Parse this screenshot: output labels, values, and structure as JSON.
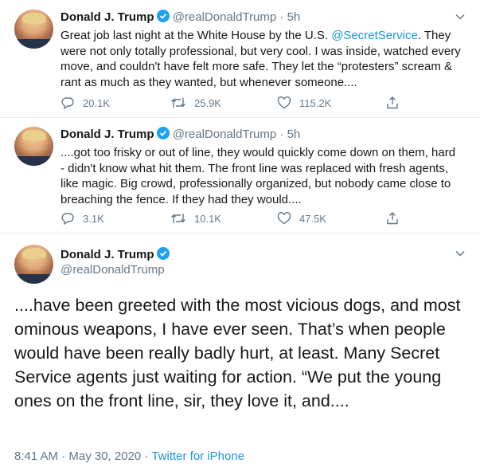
{
  "tweets": [
    {
      "name": "Donald J. Trump",
      "handle": "@realDonaldTrump",
      "sep": "·",
      "time": "5h",
      "text_before": "Great job last night at the White House by the U.S. ",
      "mention": "@SecretService",
      "text_after": ". They were not only totally professional, but very cool. I was inside, watched every move, and couldn't have felt more safe. They let the “protesters” scream & rant as much as they wanted, but whenever someone....",
      "replies": "20.1K",
      "retweets": "25.9K",
      "likes": "115.2K"
    },
    {
      "name": "Donald J. Trump",
      "handle": "@realDonaldTrump",
      "sep": "·",
      "time": "5h",
      "text": "....got too frisky or out of line, they would quickly come down on them, hard - didn't know what hit them. The front line was replaced with fresh agents, like magic. Big crowd, professionally organized, but nobody came close to breaching the fence. If they had they would....",
      "replies": "3.1K",
      "retweets": "10.1K",
      "likes": "47.5K"
    }
  ],
  "main": {
    "name": "Donald J. Trump",
    "handle": "@realDonaldTrump",
    "text": "....have been greeted with the most vicious dogs, and most ominous weapons, I have ever seen. That’s when people would have been really badly hurt, at least. Many Secret Service agents just waiting for action. “We put the young ones on the front line, sir, they love it, and....",
    "timestamp": "8:41 AM · May 30, 2020",
    "dot": " · ",
    "source": "Twitter for iPhone"
  },
  "colors": {
    "accent": "#1b95e0",
    "muted": "#657786",
    "text": "#14171a"
  }
}
